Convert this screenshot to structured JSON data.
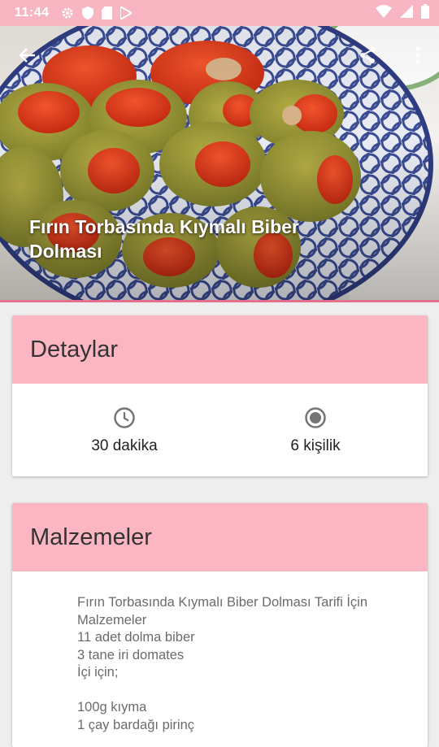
{
  "status_bar": {
    "time": "11:44",
    "left_icons": [
      "gear-icon",
      "shield-icon",
      "sim-card-icon",
      "play-store-icon"
    ],
    "right_icons": [
      "wifi-icon",
      "signal-icon",
      "battery-icon"
    ]
  },
  "hero": {
    "title": "Fırın Torbasında Kıymalı Biber Dolması",
    "image": "stuffed-peppers-photo"
  },
  "toolbar": {
    "back_icon": "arrow-back-icon",
    "share_icon": "share-icon",
    "more_icon": "more-vert-icon"
  },
  "details": {
    "heading": "Detaylar",
    "time": {
      "icon": "clock-icon",
      "label": "30 dakika"
    },
    "servings": {
      "icon": "radio-icon",
      "label": "6 kişilik"
    }
  },
  "ingredients": {
    "heading": "Malzemeler",
    "text": "Fırın Torbasında Kıymalı Biber Dolması Tarifi İçin Malzemeler\n11 adet dolma biber\n3 tane iri domates\nİçi için;\n\n100g kıyma\n1 çay bardağı pirinç"
  },
  "colors": {
    "status_bar": "#f7b6c2",
    "card_header": "#fbb6c2",
    "accent_line": "#e0708c",
    "background": "#eeeeee"
  }
}
